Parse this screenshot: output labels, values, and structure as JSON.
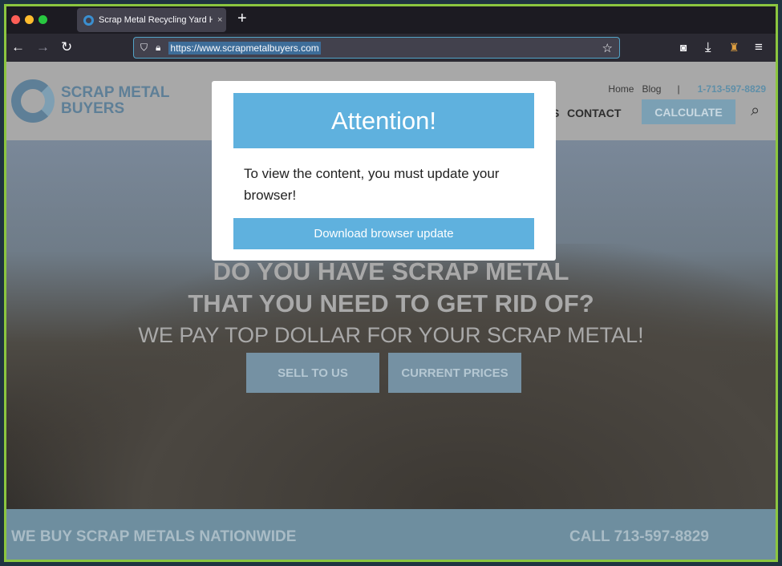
{
  "browser": {
    "tab_title": "Scrap Metal Recycling Yard Houston",
    "tab_close": "×",
    "new_tab": "+",
    "url": "https://www.scrapmetalbuyers.com"
  },
  "site": {
    "logo_line1": "SCRAP METAL",
    "logo_line2": "BUYERS",
    "top_links": [
      "Home",
      "Blog"
    ],
    "separator": "|",
    "phone": "1-713-597-8829",
    "nav_partial": "S",
    "nav_contact": "CONTACT",
    "calculate": "CALCULATE",
    "hero_line1": "DO YOU HAVE SCRAP METAL",
    "hero_line2": "THAT YOU NEED TO GET RID OF?",
    "hero_sub": "WE PAY TOP DOLLAR FOR YOUR SCRAP METAL!",
    "btn_sell": "SELL TO US",
    "btn_prices": "CURRENT PRICES",
    "bottom_left": "WE BUY SCRAP METALS NATIONWIDE",
    "bottom_right": "CALL 713-597-8829"
  },
  "modal": {
    "title": "Attention!",
    "message": "To view the content, you must update your browser!",
    "button": "Download browser update"
  },
  "colors": {
    "modal_accent": "#5fb1de",
    "frame_border": "#8cc63f"
  }
}
